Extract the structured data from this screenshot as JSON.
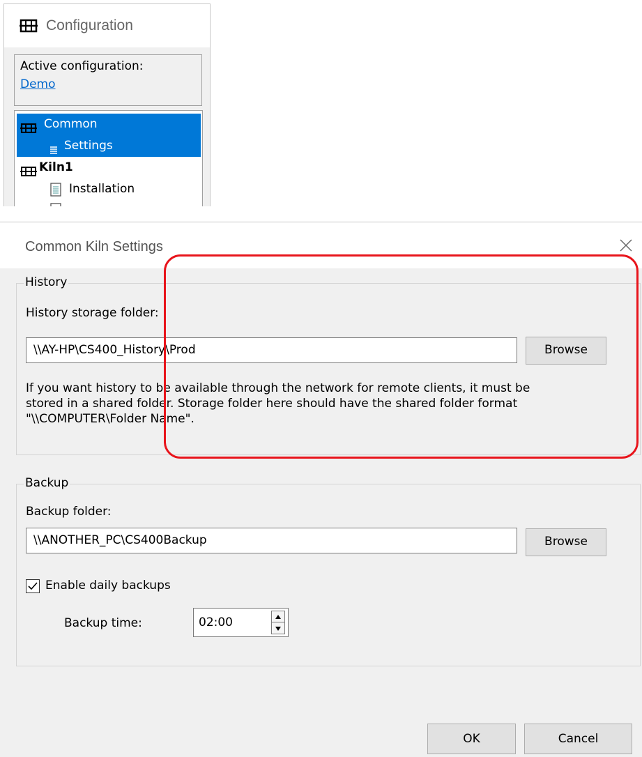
{
  "config_panel": {
    "title": "Configuration",
    "active_label": "Active configuration:",
    "active_value": "Demo",
    "tree": [
      {
        "label": "Common",
        "icon": "kiln-icon",
        "selected": true,
        "bold": false
      },
      {
        "label": "Settings",
        "icon": "list-icon",
        "selected": true,
        "bold": false
      },
      {
        "label": "Kiln1",
        "icon": "kiln-icon",
        "selected": false,
        "bold": true
      },
      {
        "label": "Installation",
        "icon": "document-icon",
        "selected": false,
        "bold": false
      }
    ]
  },
  "dialog": {
    "title": "Common Kiln Settings",
    "history": {
      "group_label": "History",
      "folder_label": "History storage folder:",
      "folder_value": "\\\\AY-HP\\CS400_History\\Prod",
      "browse_label": "Browse",
      "info_lines": [
        "If you want history to be available through the network for remote clients, it must be",
        "stored in a shared folder. Storage folder here should have the shared folder format",
        "\"\\\\COMPUTER\\Folder Name\"."
      ]
    },
    "backup": {
      "group_label": "Backup",
      "folder_label": "Backup folder:",
      "folder_value": "\\\\ANOTHER_PC\\CS400Backup",
      "browse_label": "Browse",
      "enable_label": "Enable daily backups",
      "enable_checked": true,
      "time_label": "Backup time:",
      "time_value": "02:00"
    },
    "ok_label": "OK",
    "cancel_label": "Cancel"
  },
  "colors": {
    "selection": "#0078d7",
    "link": "#0066cc",
    "highlight_ring": "#e8141b",
    "dialog_bg": "#f0f0f0"
  }
}
